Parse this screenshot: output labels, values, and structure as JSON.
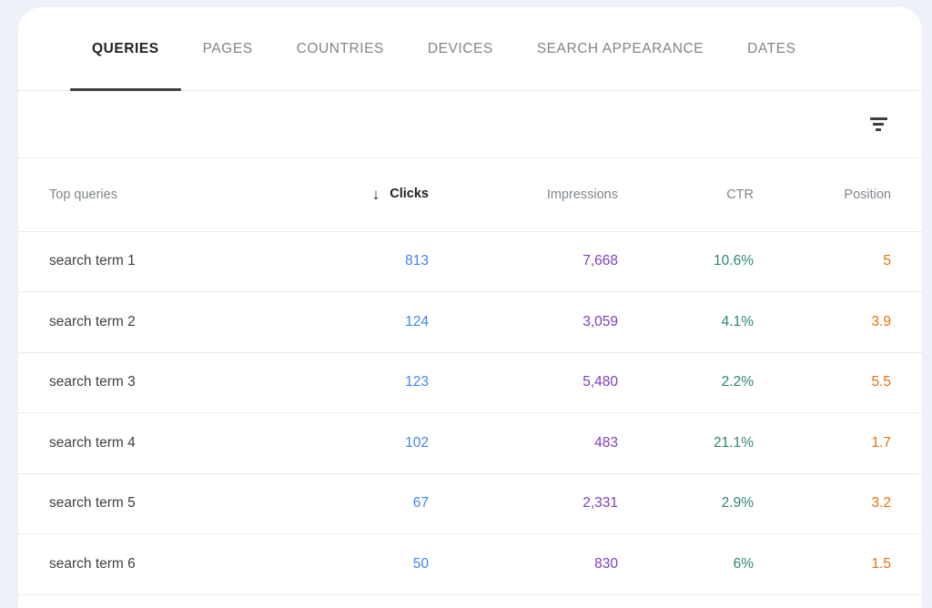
{
  "card": {
    "tabs": [
      {
        "label": "QUERIES",
        "name": "tab-queries",
        "active": true
      },
      {
        "label": "PAGES",
        "name": "tab-pages",
        "active": false
      },
      {
        "label": "COUNTRIES",
        "name": "tab-countries",
        "active": false
      },
      {
        "label": "DEVICES",
        "name": "tab-devices",
        "active": false
      },
      {
        "label": "SEARCH APPEARANCE",
        "name": "tab-search-appearance",
        "active": false
      },
      {
        "label": "DATES",
        "name": "tab-dates",
        "active": false
      }
    ],
    "toolbar": {
      "filter_icon": "filter-icon",
      "filter_label": "Filter"
    },
    "table": {
      "sort": {
        "column": "Clicks",
        "direction": "descending",
        "arrow_glyph": "↓"
      },
      "columns": [
        {
          "label": "Top queries",
          "key": "term",
          "align": "left",
          "sorted": false
        },
        {
          "label": "Clicks",
          "key": "clicks",
          "align": "right",
          "sorted": true
        },
        {
          "label": "Impressions",
          "key": "impressions",
          "align": "right",
          "sorted": false
        },
        {
          "label": "CTR",
          "key": "ctr",
          "align": "right",
          "sorted": false
        },
        {
          "label": "Position",
          "key": "position",
          "align": "right",
          "sorted": false
        }
      ],
      "rows": [
        {
          "term": "search term 1",
          "clicks": "813",
          "impressions": "7,668",
          "ctr": "10.6%",
          "position": "5"
        },
        {
          "term": "search term 2",
          "clicks": "124",
          "impressions": "3,059",
          "ctr": "4.1%",
          "position": "3.9"
        },
        {
          "term": "search term 3",
          "clicks": "123",
          "impressions": "5,480",
          "ctr": "2.2%",
          "position": "5.5"
        },
        {
          "term": "search term 4",
          "clicks": "102",
          "impressions": "483",
          "ctr": "21.1%",
          "position": "1.7"
        },
        {
          "term": "search term 5",
          "clicks": "67",
          "impressions": "2,331",
          "ctr": "2.9%",
          "position": "3.2"
        },
        {
          "term": "search term 6",
          "clicks": "50",
          "impressions": "830",
          "ctr": "6%",
          "position": "1.5"
        }
      ]
    }
  },
  "colors": {
    "page_background": "#eef1f8",
    "card_background": "#ffffff",
    "divider": "#e8eaed",
    "text_primary": "#3c4043",
    "text_secondary": "#80868b",
    "tab_active_underline": "#3c4043",
    "clicks": "#4285f4",
    "impressions": "#7e3ec2",
    "ctr": "#2d8577",
    "position": "#e8710a"
  }
}
